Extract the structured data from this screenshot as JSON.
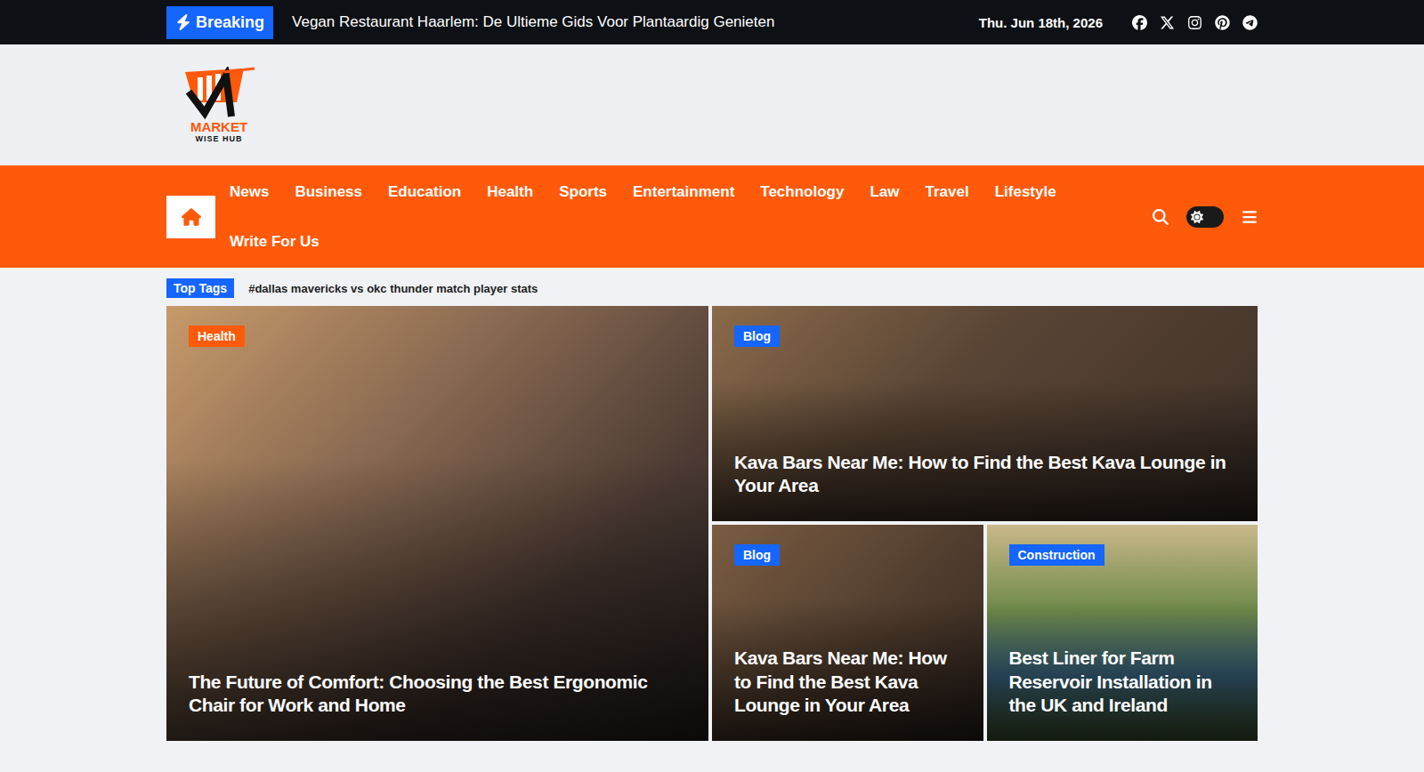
{
  "topbar": {
    "breaking_label": "Breaking",
    "headline": "Vegan Restaurant Haarlem: De Ultieme Gids Voor Plantaardig Genieten",
    "date": "Thu. Jun 18th, 2026"
  },
  "logo": {
    "title": "MARKET",
    "subtitle": "WISE HUB"
  },
  "nav": {
    "home_selected": true,
    "items": [
      {
        "label": "News",
        "selected": false
      },
      {
        "label": "Business",
        "selected": false
      },
      {
        "label": "Education",
        "selected": false
      },
      {
        "label": "Health",
        "selected": false
      },
      {
        "label": "Sports",
        "selected": false
      },
      {
        "label": "Entertainment",
        "selected": false
      },
      {
        "label": "Technology",
        "selected": false
      },
      {
        "label": "Law",
        "selected": false
      },
      {
        "label": "Travel",
        "selected": false
      },
      {
        "label": "Lifestyle",
        "selected": false
      },
      {
        "label": "Write For Us",
        "selected": false
      }
    ],
    "dark_mode": false
  },
  "top_tags": {
    "label": "Top Tags",
    "tags": [
      "dallas mavericks vs okc thunder match player stats"
    ],
    "prefix": "#"
  },
  "posts": [
    {
      "kind": "large",
      "category": "Health",
      "color": "#ff5a0a",
      "title": "The Future of Comfort: Choosing the Best Ergonomic Chair for Work and Home"
    },
    {
      "kind": "wide",
      "category": "Blog",
      "color": "#1565ff",
      "title": "Kava Bars Near Me: How to Find the Best Kava Lounge in Your Area"
    },
    {
      "kind": "small",
      "category": "Blog",
      "color": "#1565ff",
      "title": "Kava Bars Near Me: How to Find the Best Kava Lounge in Your Area"
    },
    {
      "kind": "small",
      "category": "Construction",
      "color": "#1565ff",
      "title": "Best Liner for Farm Reservoir Installation in the UK and Ireland"
    }
  ]
}
